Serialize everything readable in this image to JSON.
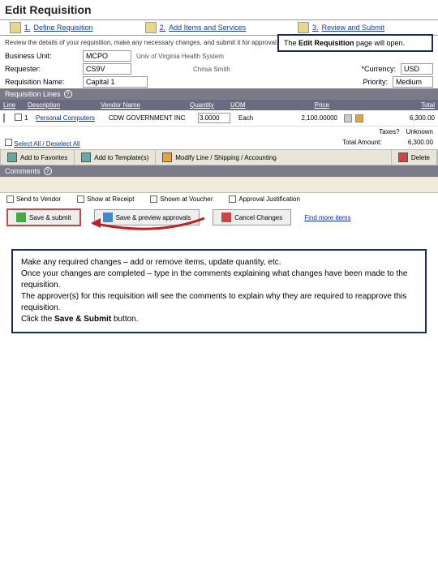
{
  "page_title": "Edit Requisition",
  "wizard": [
    {
      "num": "1.",
      "label": "Define Requisition"
    },
    {
      "num": "2.",
      "label": "Add Items and Services"
    },
    {
      "num": "3.",
      "label": "Review and Submit"
    }
  ],
  "intro": "Review the details of your requisition, make any necessary changes, and submit it for approval.",
  "callout_top": {
    "prefix": "The ",
    "bold": "Edit Requisition",
    "suffix": " page will open."
  },
  "form": {
    "business_unit_label": "Business Unit:",
    "business_unit_value": "MCPO",
    "bu_desc": "Univ of Virginia Health System",
    "requester_label": "Requester:",
    "requester_value": "CS9V",
    "requester_name": "Chrisa Smith",
    "currency_label": "*Currency:",
    "currency_value": "USD",
    "req_name_label": "Requisition Name:",
    "req_name_value": "Capital 1",
    "priority_label": "Priority:",
    "priority_value": "Medium"
  },
  "lines_section": "Requisition Lines",
  "table": {
    "headers": {
      "line": "Line",
      "desc": "Description",
      "vendor": "Vendor Name",
      "qty": "Quantity",
      "uom": "UOM",
      "price": "Price",
      "total": "Total"
    },
    "row": {
      "line": "1",
      "desc": "Personal Computers",
      "vendor": "CDW GOVERNMENT INC",
      "qty": "3.0000",
      "uom": "Each",
      "price": "2,100.00000",
      "total": "6,300.00"
    },
    "taxes_label": "Taxes?",
    "taxes_value": "Unknown",
    "select_all": "Select All / Deselect All",
    "total_amount_label": "Total Amount:",
    "total_amount_value": "6,300.00"
  },
  "toolbar": {
    "fav": "Add to Favorites",
    "tpl": "Add to Template(s)",
    "modify": "Modify Line / Shipping / Accounting",
    "delete": "Delete"
  },
  "comments_section": "Comments",
  "checks": {
    "send_vendor": "Send to Vendor",
    "show_receipt": "Show at Receipt",
    "show_voucher": "Shown at Voucher",
    "approval": "Approval Justification"
  },
  "actions": {
    "save": "Save & submit",
    "preview": "Save & preview approvals",
    "cancel": "Cancel Changes",
    "find": "Find more items"
  },
  "callout_main": {
    "l1": "Make any required changes – add or remove items, update quantity, etc.",
    "l2": "Once your changes are completed – type in the comments explaining what changes have been made to the requisition.",
    "l3": "The approver(s) for this requisition will see the comments to explain why they are required to reapprove this requisition.",
    "l4a": "Click the ",
    "l4b": "Save & Submit",
    "l4c": " button."
  }
}
